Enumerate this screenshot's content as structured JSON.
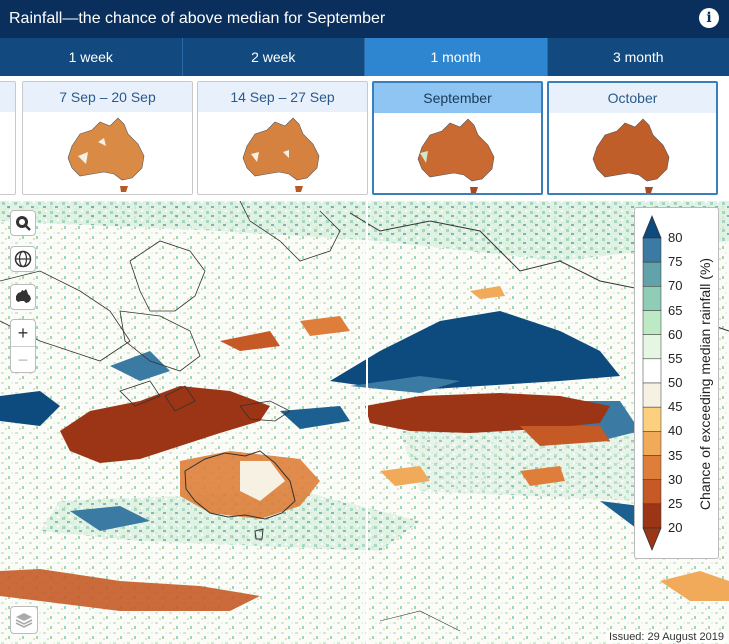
{
  "header": {
    "title": "Rainfall—the chance of above median for September",
    "info_icon": "info-icon"
  },
  "tabs": [
    {
      "label": "1 week",
      "active": false
    },
    {
      "label": "2 week",
      "active": false
    },
    {
      "label": "1 month",
      "active": true
    },
    {
      "label": "3 month",
      "active": false
    }
  ],
  "thumbnails": [
    {
      "label": "7 Sep – 20 Sep",
      "selected": false
    },
    {
      "label": "14 Sep – 27 Sep",
      "selected": false
    },
    {
      "label": "September",
      "selected": true
    },
    {
      "label": "October",
      "selected": false
    }
  ],
  "map_controls": {
    "search_icon": "search-icon",
    "globe_icon": "globe-icon",
    "australia_icon": "australia-map-icon",
    "zoom_in_label": "+",
    "zoom_out_label": "−",
    "layers_icon": "layers-icon"
  },
  "legend": {
    "title": "Chance of exceeding median rainfall (%)",
    "ticks": [
      "80",
      "75",
      "70",
      "65",
      "60",
      "55",
      "50",
      "45",
      "40",
      "35",
      "30",
      "25",
      "20"
    ],
    "colors": [
      "#0d4a7e",
      "#3a7aa3",
      "#62a3aa",
      "#8fcdb7",
      "#bdeac4",
      "#e5f6e3",
      "#ffffff",
      "#f6f1e3",
      "#fcd07e",
      "#f1a95a",
      "#de7e3a",
      "#c55a26",
      "#9c3516"
    ]
  },
  "issued": "Issued: 29 August 2019",
  "colors": {
    "header_bg": "#0a2f5c",
    "tab_bg": "#12497e",
    "tab_active": "#2f86d0"
  }
}
